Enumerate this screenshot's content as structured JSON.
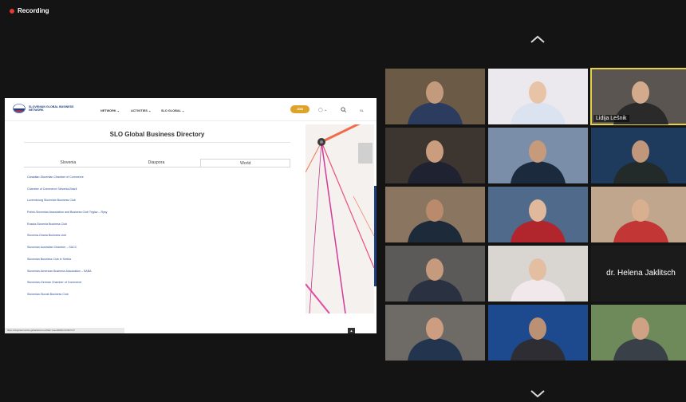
{
  "recording": {
    "label": "Recording",
    "color": "#e53935"
  },
  "shared_screen": {
    "site": {
      "logo_text": "SLOVENIAN GLOBAL BUSINESS NETWORK",
      "nav": [
        "NETWORK ⌄",
        "ACTIVITIES ⌄",
        "SLO GLOBAL ⌄"
      ],
      "join_label": "JOIN",
      "user_menu": "◯ ⌄"
    },
    "title": "SLO Global Business Directory",
    "tabs": [
      {
        "label": "Slovenia",
        "active": false
      },
      {
        "label": "Diaspora",
        "active": false
      },
      {
        "label": "World",
        "active": true
      }
    ],
    "directory": [
      "Canadian-Slovenian Chamber of Commerce",
      "Chamber of Commerce Slovenia-Brazil",
      "Luxembourg Slovenian Business Club",
      "Polish-Slovenian Association and Business Club Triglav – Rysy",
      "Russia-Slovenia Business Club",
      "Slovenia-Ghana Business club",
      "Slovenian Australian Chamber – SACC",
      "Slovenian Business Club in Serbia",
      "Slovenian-American Business Association – SABA",
      "Slovenian-German Chamber of Commerce",
      "Slovenian-Slovak Business Club"
    ],
    "status_url": "https://sloglobal.net/slo-global/about-us/#tab-7aeed093bc313847c37"
  },
  "gallery": {
    "participants": [
      {
        "name": "",
        "bg": "#6b5a45",
        "skin": "#c49a7c",
        "shirt": "#2c3c5e"
      },
      {
        "name": "",
        "bg": "#ece9ee",
        "skin": "#e8c3a6",
        "shirt": "#dbe3f1"
      },
      {
        "name": "Lidija Lešnik",
        "bg": "#5a5550",
        "skin": "#d4aa8d",
        "shirt": "#2a2a2a",
        "active_speaker": true
      },
      {
        "name": "",
        "bg": "#3d3530",
        "skin": "#c99d7e",
        "shirt": "#1f2230"
      },
      {
        "name": "",
        "bg": "#7a8eaa",
        "skin": "#c69b7c",
        "shirt": "#1b2a3c"
      },
      {
        "name": "",
        "bg": "#1e3a5c",
        "skin": "#c0977a",
        "shirt": "#222a2a"
      },
      {
        "name": "",
        "bg": "#8a7660",
        "skin": "#b98a6c",
        "shirt": "#1c2a3a"
      },
      {
        "name": "",
        "bg": "#4f6a8a",
        "skin": "#e0b99c",
        "shirt": "#b1262c"
      },
      {
        "name": "",
        "bg": "#bfa68c",
        "skin": "#d9b08f",
        "shirt": "#c23636"
      },
      {
        "name": "",
        "bg": "#5c5a58",
        "skin": "#c59a7d",
        "shirt": "#2a3140"
      },
      {
        "name": "",
        "bg": "#d9d6d2",
        "skin": "#e3bea0",
        "shirt": "#f0e8ea"
      },
      {
        "name": "dr. Helena Jaklitsch",
        "bg": "#1b1b1b",
        "skin": "",
        "shirt": "",
        "name_only": true
      },
      {
        "name": "",
        "bg": "#6e6a66",
        "skin": "#cc9d80",
        "shirt": "#23344f"
      },
      {
        "name": "",
        "bg": "#1d4a8e",
        "skin": "#bb9176",
        "shirt": "#2d2d33"
      },
      {
        "name": "",
        "bg": "#6e8a5a",
        "skin": "#cfa286",
        "shirt": "#3a4048"
      }
    ]
  }
}
